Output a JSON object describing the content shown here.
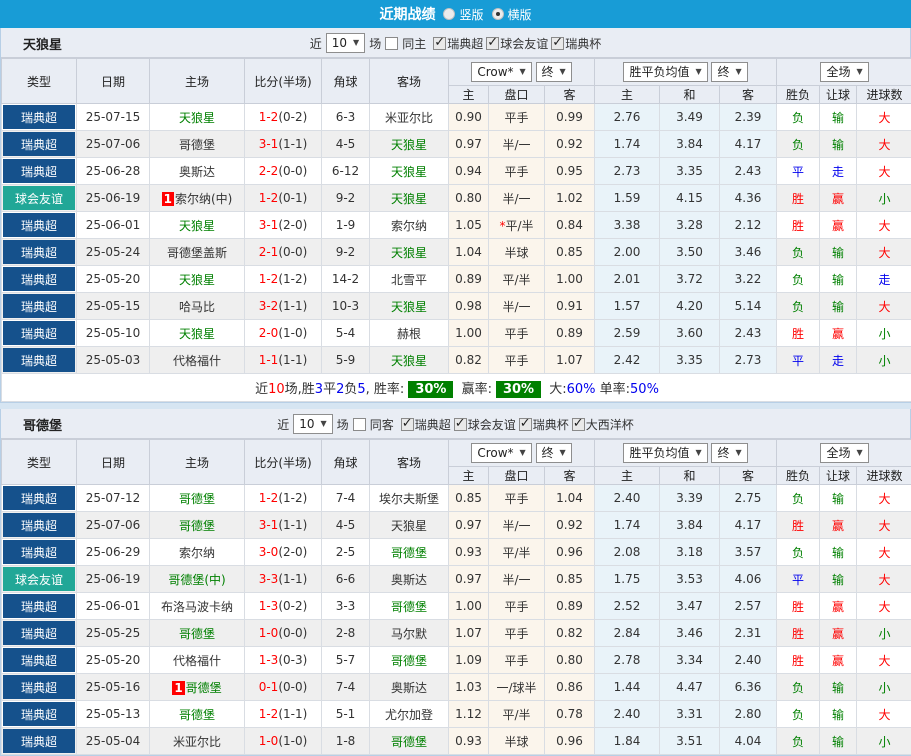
{
  "topbar": {
    "title": "近期战绩",
    "options": [
      {
        "label": "竖版",
        "checked": false
      },
      {
        "label": "横版",
        "checked": true
      }
    ]
  },
  "header": {
    "recent_label": "近",
    "games_label": "场",
    "type": "类型",
    "date": "日期",
    "home": "主场",
    "score": "比分(半场)",
    "corner": "角球",
    "away": "客场",
    "bookmaker": "Crow*",
    "odds_period": "终",
    "mean": "胜平负均值",
    "mean_period": "终",
    "scope": "全场",
    "odds_home": "主",
    "odds_handicap": "盘口",
    "odds_away": "客",
    "mean_home": "主",
    "mean_draw": "和",
    "mean_away": "客",
    "res_wdl": "胜负",
    "res_handicap": "让球",
    "res_goals": "进球数"
  },
  "colors": {
    "accent_blue": "#189CD6",
    "league_badge": "#15518C",
    "friendly_badge": "#21A797",
    "win_red": "#FF0000",
    "lose_green": "#008000",
    "draw_blue": "#0000EE",
    "rate_badge_green": "#008000"
  },
  "sections": [
    {
      "team": "天狼星",
      "filters": {
        "count": "10",
        "same_label": "同主",
        "same_checked": false,
        "comps": [
          {
            "label": "瑞典超",
            "checked": true
          },
          {
            "label": "球会友谊",
            "checked": true
          },
          {
            "label": "瑞典杯",
            "checked": true
          }
        ]
      },
      "rows": [
        {
          "league": "瑞典超",
          "league_style": "super",
          "date": "25-07-15",
          "home": {
            "name": "天狼星",
            "green": true,
            "badge": false
          },
          "away": {
            "name": "米亚尔比",
            "green": false
          },
          "score": "1-2",
          "half": "(0-2)",
          "corner": "6-3",
          "odds": [
            "0.90",
            "平手",
            "0.99"
          ],
          "star": false,
          "means": [
            "2.76",
            "3.49",
            "2.39"
          ],
          "res": [
            [
              "负",
              "green"
            ],
            [
              "输",
              "green"
            ],
            [
              "大",
              "red"
            ]
          ]
        },
        {
          "league": "瑞典超",
          "league_style": "super",
          "date": "25-07-06",
          "home": {
            "name": "哥德堡",
            "green": false,
            "badge": false
          },
          "away": {
            "name": "天狼星",
            "green": true
          },
          "score": "3-1",
          "half": "(1-1)",
          "corner": "4-5",
          "odds": [
            "0.97",
            "半/一",
            "0.92"
          ],
          "star": false,
          "means": [
            "1.74",
            "3.84",
            "4.17"
          ],
          "res": [
            [
              "负",
              "green"
            ],
            [
              "输",
              "green"
            ],
            [
              "大",
              "red"
            ]
          ]
        },
        {
          "league": "瑞典超",
          "league_style": "super",
          "date": "25-06-28",
          "home": {
            "name": "奥斯达",
            "green": false,
            "badge": false
          },
          "away": {
            "name": "天狼星",
            "green": true
          },
          "score": "2-2",
          "half": "(0-0)",
          "corner": "6-12",
          "odds": [
            "0.94",
            "平手",
            "0.95"
          ],
          "star": false,
          "means": [
            "2.73",
            "3.35",
            "2.43"
          ],
          "res": [
            [
              "平",
              "blue"
            ],
            [
              "走",
              "blue"
            ],
            [
              "大",
              "red"
            ]
          ]
        },
        {
          "league": "球会友谊",
          "league_style": "friendly",
          "date": "25-06-19",
          "home": {
            "name": "索尔纳(中)",
            "green": false,
            "badge": true
          },
          "away": {
            "name": "天狼星",
            "green": true
          },
          "score": "1-2",
          "half": "(0-1)",
          "corner": "9-2",
          "odds": [
            "0.80",
            "半/一",
            "1.02"
          ],
          "star": false,
          "means": [
            "1.59",
            "4.15",
            "4.36"
          ],
          "res": [
            [
              "胜",
              "red"
            ],
            [
              "赢",
              "red"
            ],
            [
              "小",
              "green"
            ]
          ]
        },
        {
          "league": "瑞典超",
          "league_style": "super",
          "date": "25-06-01",
          "home": {
            "name": "天狼星",
            "green": true,
            "badge": false
          },
          "away": {
            "name": "索尔纳",
            "green": false
          },
          "score": "3-1",
          "half": "(2-0)",
          "corner": "1-9",
          "odds": [
            "1.05",
            "平/半",
            "0.84"
          ],
          "star": true,
          "means": [
            "3.38",
            "3.28",
            "2.12"
          ],
          "res": [
            [
              "胜",
              "red"
            ],
            [
              "赢",
              "red"
            ],
            [
              "大",
              "red"
            ]
          ]
        },
        {
          "league": "瑞典超",
          "league_style": "super",
          "date": "25-05-24",
          "home": {
            "name": "哥德堡盖斯",
            "green": false,
            "badge": false
          },
          "away": {
            "name": "天狼星",
            "green": true
          },
          "score": "2-1",
          "half": "(0-0)",
          "corner": "9-2",
          "odds": [
            "1.04",
            "半球",
            "0.85"
          ],
          "star": false,
          "means": [
            "2.00",
            "3.50",
            "3.46"
          ],
          "res": [
            [
              "负",
              "green"
            ],
            [
              "输",
              "green"
            ],
            [
              "大",
              "red"
            ]
          ]
        },
        {
          "league": "瑞典超",
          "league_style": "super",
          "date": "25-05-20",
          "home": {
            "name": "天狼星",
            "green": true,
            "badge": false
          },
          "away": {
            "name": "北雪平",
            "green": false
          },
          "score": "1-2",
          "half": "(1-2)",
          "corner": "14-2",
          "odds": [
            "0.89",
            "平/半",
            "1.00"
          ],
          "star": false,
          "means": [
            "2.01",
            "3.72",
            "3.22"
          ],
          "res": [
            [
              "负",
              "green"
            ],
            [
              "输",
              "green"
            ],
            [
              "走",
              "blue"
            ]
          ]
        },
        {
          "league": "瑞典超",
          "league_style": "super",
          "date": "25-05-15",
          "home": {
            "name": "哈马比",
            "green": false,
            "badge": false
          },
          "away": {
            "name": "天狼星",
            "green": true
          },
          "score": "3-2",
          "half": "(1-1)",
          "corner": "10-3",
          "odds": [
            "0.98",
            "半/一",
            "0.91"
          ],
          "star": false,
          "means": [
            "1.57",
            "4.20",
            "5.14"
          ],
          "res": [
            [
              "负",
              "green"
            ],
            [
              "输",
              "green"
            ],
            [
              "大",
              "red"
            ]
          ]
        },
        {
          "league": "瑞典超",
          "league_style": "super",
          "date": "25-05-10",
          "home": {
            "name": "天狼星",
            "green": true,
            "badge": false
          },
          "away": {
            "name": "赫根",
            "green": false
          },
          "score": "2-0",
          "half": "(1-0)",
          "corner": "5-4",
          "odds": [
            "1.00",
            "平手",
            "0.89"
          ],
          "star": false,
          "means": [
            "2.59",
            "3.60",
            "2.43"
          ],
          "res": [
            [
              "胜",
              "red"
            ],
            [
              "赢",
              "red"
            ],
            [
              "小",
              "green"
            ]
          ]
        },
        {
          "league": "瑞典超",
          "league_style": "super",
          "date": "25-05-03",
          "home": {
            "name": "代格福什",
            "green": false,
            "badge": false
          },
          "away": {
            "name": "天狼星",
            "green": true
          },
          "score": "1-1",
          "half": "(1-1)",
          "corner": "5-9",
          "odds": [
            "0.82",
            "平手",
            "1.07"
          ],
          "star": false,
          "means": [
            "2.42",
            "3.35",
            "2.73"
          ],
          "res": [
            [
              "平",
              "blue"
            ],
            [
              "走",
              "blue"
            ],
            [
              "小",
              "green"
            ]
          ]
        }
      ],
      "summary": [
        {
          "t": "近",
          "c": "dark"
        },
        {
          "t": "10",
          "c": "red"
        },
        {
          "t": "场,胜",
          "c": "dark"
        },
        {
          "t": "3",
          "c": "blue"
        },
        {
          "t": "平",
          "c": "dark"
        },
        {
          "t": "2",
          "c": "blue"
        },
        {
          "t": "负",
          "c": "dark"
        },
        {
          "t": "5",
          "c": "blue"
        },
        {
          "t": ", 胜率:",
          "c": "dark"
        },
        {
          "t": "30%",
          "c": "badge"
        },
        {
          "t": " 赢率:",
          "c": "dark"
        },
        {
          "t": "30%",
          "c": "badge"
        },
        {
          "t": " 大:",
          "c": "dark"
        },
        {
          "t": "60%",
          "c": "blue"
        },
        {
          "t": " 单率:",
          "c": "dark"
        },
        {
          "t": "50%",
          "c": "blue"
        }
      ]
    },
    {
      "team": "哥德堡",
      "filters": {
        "count": "10",
        "same_label": "同客",
        "same_checked": false,
        "comps": [
          {
            "label": "瑞典超",
            "checked": true
          },
          {
            "label": "球会友谊",
            "checked": true
          },
          {
            "label": "瑞典杯",
            "checked": true
          },
          {
            "label": "大西洋杯",
            "checked": true
          }
        ]
      },
      "rows": [
        {
          "league": "瑞典超",
          "league_style": "super",
          "date": "25-07-12",
          "home": {
            "name": "哥德堡",
            "green": true,
            "badge": false
          },
          "away": {
            "name": "埃尔夫斯堡",
            "green": false
          },
          "score": "1-2",
          "half": "(1-2)",
          "corner": "7-4",
          "odds": [
            "0.85",
            "平手",
            "1.04"
          ],
          "star": false,
          "means": [
            "2.40",
            "3.39",
            "2.75"
          ],
          "res": [
            [
              "负",
              "green"
            ],
            [
              "输",
              "green"
            ],
            [
              "大",
              "red"
            ]
          ]
        },
        {
          "league": "瑞典超",
          "league_style": "super",
          "date": "25-07-06",
          "home": {
            "name": "哥德堡",
            "green": true,
            "badge": false
          },
          "away": {
            "name": "天狼星",
            "green": false
          },
          "score": "3-1",
          "half": "(1-1)",
          "corner": "4-5",
          "odds": [
            "0.97",
            "半/一",
            "0.92"
          ],
          "star": false,
          "means": [
            "1.74",
            "3.84",
            "4.17"
          ],
          "res": [
            [
              "胜",
              "red"
            ],
            [
              "赢",
              "red"
            ],
            [
              "大",
              "red"
            ]
          ]
        },
        {
          "league": "瑞典超",
          "league_style": "super",
          "date": "25-06-29",
          "home": {
            "name": "索尔纳",
            "green": false,
            "badge": false
          },
          "away": {
            "name": "哥德堡",
            "green": true
          },
          "score": "3-0",
          "half": "(2-0)",
          "corner": "2-5",
          "odds": [
            "0.93",
            "平/半",
            "0.96"
          ],
          "star": false,
          "means": [
            "2.08",
            "3.18",
            "3.57"
          ],
          "res": [
            [
              "负",
              "green"
            ],
            [
              "输",
              "green"
            ],
            [
              "大",
              "red"
            ]
          ]
        },
        {
          "league": "球会友谊",
          "league_style": "friendly",
          "date": "25-06-19",
          "home": {
            "name": "哥德堡(中)",
            "green": true,
            "badge": false
          },
          "away": {
            "name": "奥斯达",
            "green": false
          },
          "score": "3-3",
          "half": "(1-1)",
          "corner": "6-6",
          "odds": [
            "0.97",
            "半/一",
            "0.85"
          ],
          "star": false,
          "means": [
            "1.75",
            "3.53",
            "4.06"
          ],
          "res": [
            [
              "平",
              "blue"
            ],
            [
              "输",
              "green"
            ],
            [
              "大",
              "red"
            ]
          ]
        },
        {
          "league": "瑞典超",
          "league_style": "super",
          "date": "25-06-01",
          "home": {
            "name": "布洛马波卡纳",
            "green": false,
            "badge": false
          },
          "away": {
            "name": "哥德堡",
            "green": true
          },
          "score": "1-3",
          "half": "(0-2)",
          "corner": "3-3",
          "odds": [
            "1.00",
            "平手",
            "0.89"
          ],
          "star": false,
          "means": [
            "2.52",
            "3.47",
            "2.57"
          ],
          "res": [
            [
              "胜",
              "red"
            ],
            [
              "赢",
              "red"
            ],
            [
              "大",
              "red"
            ]
          ]
        },
        {
          "league": "瑞典超",
          "league_style": "super",
          "date": "25-05-25",
          "home": {
            "name": "哥德堡",
            "green": true,
            "badge": false
          },
          "away": {
            "name": "马尔默",
            "green": false
          },
          "score": "1-0",
          "half": "(0-0)",
          "corner": "2-8",
          "odds": [
            "1.07",
            "平手",
            "0.82"
          ],
          "star": false,
          "means": [
            "2.84",
            "3.46",
            "2.31"
          ],
          "res": [
            [
              "胜",
              "red"
            ],
            [
              "赢",
              "red"
            ],
            [
              "小",
              "green"
            ]
          ]
        },
        {
          "league": "瑞典超",
          "league_style": "super",
          "date": "25-05-20",
          "home": {
            "name": "代格福什",
            "green": false,
            "badge": false
          },
          "away": {
            "name": "哥德堡",
            "green": true
          },
          "score": "1-3",
          "half": "(0-3)",
          "corner": "5-7",
          "odds": [
            "1.09",
            "平手",
            "0.80"
          ],
          "star": false,
          "means": [
            "2.78",
            "3.34",
            "2.40"
          ],
          "res": [
            [
              "胜",
              "red"
            ],
            [
              "赢",
              "red"
            ],
            [
              "大",
              "red"
            ]
          ]
        },
        {
          "league": "瑞典超",
          "league_style": "super",
          "date": "25-05-16",
          "home": {
            "name": "哥德堡",
            "green": true,
            "badge": true
          },
          "away": {
            "name": "奥斯达",
            "green": false
          },
          "score": "0-1",
          "half": "(0-0)",
          "corner": "7-4",
          "odds": [
            "1.03",
            "一/球半",
            "0.86"
          ],
          "star": false,
          "means": [
            "1.44",
            "4.47",
            "6.36"
          ],
          "res": [
            [
              "负",
              "green"
            ],
            [
              "输",
              "green"
            ],
            [
              "小",
              "green"
            ]
          ]
        },
        {
          "league": "瑞典超",
          "league_style": "super",
          "date": "25-05-13",
          "home": {
            "name": "哥德堡",
            "green": true,
            "badge": false
          },
          "away": {
            "name": "尤尔加登",
            "green": false
          },
          "score": "1-2",
          "half": "(1-1)",
          "corner": "5-1",
          "odds": [
            "1.12",
            "平/半",
            "0.78"
          ],
          "star": false,
          "means": [
            "2.40",
            "3.31",
            "2.80"
          ],
          "res": [
            [
              "负",
              "green"
            ],
            [
              "输",
              "green"
            ],
            [
              "大",
              "red"
            ]
          ]
        },
        {
          "league": "瑞典超",
          "league_style": "super",
          "date": "25-05-04",
          "home": {
            "name": "米亚尔比",
            "green": false,
            "badge": false
          },
          "away": {
            "name": "哥德堡",
            "green": true
          },
          "score": "1-0",
          "half": "(1-0)",
          "corner": "1-8",
          "odds": [
            "0.93",
            "半球",
            "0.96"
          ],
          "star": false,
          "means": [
            "1.84",
            "3.51",
            "4.04"
          ],
          "res": [
            [
              "负",
              "green"
            ],
            [
              "输",
              "green"
            ],
            [
              "小",
              "green"
            ]
          ]
        }
      ],
      "summary": null
    }
  ]
}
